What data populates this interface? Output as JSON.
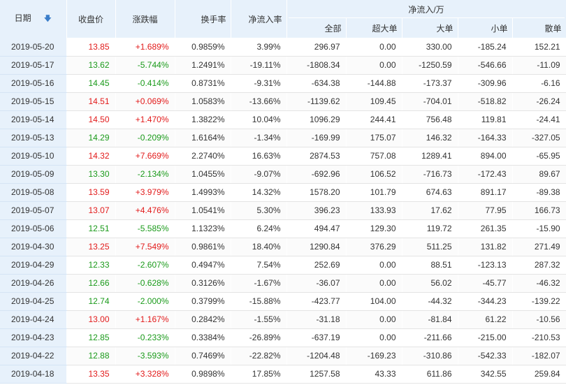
{
  "colors": {
    "up": "#e21a1a",
    "down": "#1a9a1a",
    "header_bg": "#e7f1fb"
  },
  "header": {
    "date": "日期",
    "sort_icon": "down-arrow-icon",
    "close": "收盘价",
    "change": "涨跌幅",
    "turnover": "换手率",
    "net_rate": "净流入率",
    "net_group": "净流入/万",
    "all": "全部",
    "super_large": "超大单",
    "large": "大单",
    "small": "小单",
    "retail": "散单"
  },
  "rows": [
    {
      "date": "2019-05-20",
      "close": "13.85",
      "change": "+1.689%",
      "turnover": "0.9859%",
      "net_rate": "3.99%",
      "all": "296.97",
      "super_large": "0.00",
      "large": "330.00",
      "small": "-185.24",
      "retail": "152.21",
      "dir": "up"
    },
    {
      "date": "2019-05-17",
      "close": "13.62",
      "change": "-5.744%",
      "turnover": "1.2491%",
      "net_rate": "-19.11%",
      "all": "-1808.34",
      "super_large": "0.00",
      "large": "-1250.59",
      "small": "-546.66",
      "retail": "-11.09",
      "dir": "down"
    },
    {
      "date": "2019-05-16",
      "close": "14.45",
      "change": "-0.414%",
      "turnover": "0.8731%",
      "net_rate": "-9.31%",
      "all": "-634.38",
      "super_large": "-144.88",
      "large": "-173.37",
      "small": "-309.96",
      "retail": "-6.16",
      "dir": "down"
    },
    {
      "date": "2019-05-15",
      "close": "14.51",
      "change": "+0.069%",
      "turnover": "1.0583%",
      "net_rate": "-13.66%",
      "all": "-1139.62",
      "super_large": "109.45",
      "large": "-704.01",
      "small": "-518.82",
      "retail": "-26.24",
      "dir": "up"
    },
    {
      "date": "2019-05-14",
      "close": "14.50",
      "change": "+1.470%",
      "turnover": "1.3822%",
      "net_rate": "10.04%",
      "all": "1096.29",
      "super_large": "244.41",
      "large": "756.48",
      "small": "119.81",
      "retail": "-24.41",
      "dir": "up"
    },
    {
      "date": "2019-05-13",
      "close": "14.29",
      "change": "-0.209%",
      "turnover": "1.6164%",
      "net_rate": "-1.34%",
      "all": "-169.99",
      "super_large": "175.07",
      "large": "146.32",
      "small": "-164.33",
      "retail": "-327.05",
      "dir": "down"
    },
    {
      "date": "2019-05-10",
      "close": "14.32",
      "change": "+7.669%",
      "turnover": "2.2740%",
      "net_rate": "16.63%",
      "all": "2874.53",
      "super_large": "757.08",
      "large": "1289.41",
      "small": "894.00",
      "retail": "-65.95",
      "dir": "up"
    },
    {
      "date": "2019-05-09",
      "close": "13.30",
      "change": "-2.134%",
      "turnover": "1.0455%",
      "net_rate": "-9.07%",
      "all": "-692.96",
      "super_large": "106.52",
      "large": "-716.73",
      "small": "-172.43",
      "retail": "89.67",
      "dir": "down"
    },
    {
      "date": "2019-05-08",
      "close": "13.59",
      "change": "+3.979%",
      "turnover": "1.4993%",
      "net_rate": "14.32%",
      "all": "1578.20",
      "super_large": "101.79",
      "large": "674.63",
      "small": "891.17",
      "retail": "-89.38",
      "dir": "up"
    },
    {
      "date": "2019-05-07",
      "close": "13.07",
      "change": "+4.476%",
      "turnover": "1.0541%",
      "net_rate": "5.30%",
      "all": "396.23",
      "super_large": "133.93",
      "large": "17.62",
      "small": "77.95",
      "retail": "166.73",
      "dir": "up"
    },
    {
      "date": "2019-05-06",
      "close": "12.51",
      "change": "-5.585%",
      "turnover": "1.1323%",
      "net_rate": "6.24%",
      "all": "494.47",
      "super_large": "129.30",
      "large": "119.72",
      "small": "261.35",
      "retail": "-15.90",
      "dir": "down"
    },
    {
      "date": "2019-04-30",
      "close": "13.25",
      "change": "+7.549%",
      "turnover": "0.9861%",
      "net_rate": "18.40%",
      "all": "1290.84",
      "super_large": "376.29",
      "large": "511.25",
      "small": "131.82",
      "retail": "271.49",
      "dir": "up"
    },
    {
      "date": "2019-04-29",
      "close": "12.33",
      "change": "-2.607%",
      "turnover": "0.4947%",
      "net_rate": "7.54%",
      "all": "252.69",
      "super_large": "0.00",
      "large": "88.51",
      "small": "-123.13",
      "retail": "287.32",
      "dir": "down"
    },
    {
      "date": "2019-04-26",
      "close": "12.66",
      "change": "-0.628%",
      "turnover": "0.3126%",
      "net_rate": "-1.67%",
      "all": "-36.07",
      "super_large": "0.00",
      "large": "56.02",
      "small": "-45.77",
      "retail": "-46.32",
      "dir": "down"
    },
    {
      "date": "2019-04-25",
      "close": "12.74",
      "change": "-2.000%",
      "turnover": "0.3799%",
      "net_rate": "-15.88%",
      "all": "-423.77",
      "super_large": "104.00",
      "large": "-44.32",
      "small": "-344.23",
      "retail": "-139.22",
      "dir": "down"
    },
    {
      "date": "2019-04-24",
      "close": "13.00",
      "change": "+1.167%",
      "turnover": "0.2842%",
      "net_rate": "-1.55%",
      "all": "-31.18",
      "super_large": "0.00",
      "large": "-81.84",
      "small": "61.22",
      "retail": "-10.56",
      "dir": "up"
    },
    {
      "date": "2019-04-23",
      "close": "12.85",
      "change": "-0.233%",
      "turnover": "0.3384%",
      "net_rate": "-26.89%",
      "all": "-637.19",
      "super_large": "0.00",
      "large": "-211.66",
      "small": "-215.00",
      "retail": "-210.53",
      "dir": "down"
    },
    {
      "date": "2019-04-22",
      "close": "12.88",
      "change": "-3.593%",
      "turnover": "0.7469%",
      "net_rate": "-22.82%",
      "all": "-1204.48",
      "super_large": "-169.23",
      "large": "-310.86",
      "small": "-542.33",
      "retail": "-182.07",
      "dir": "down"
    },
    {
      "date": "2019-04-18",
      "close": "13.35",
      "change": "+3.328%",
      "turnover": "0.9898%",
      "net_rate": "17.85%",
      "all": "1257.58",
      "super_large": "43.33",
      "large": "611.86",
      "small": "342.55",
      "retail": "259.84",
      "dir": "up"
    }
  ]
}
